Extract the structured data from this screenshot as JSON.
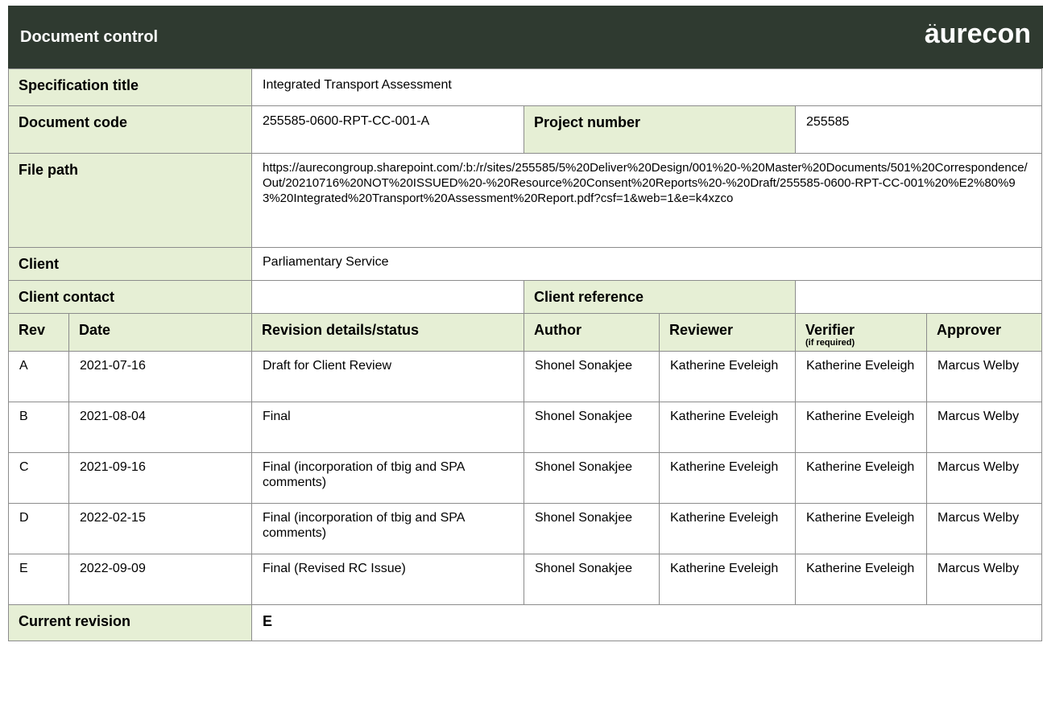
{
  "header": {
    "title": "Document control",
    "logo_text": "aurecon"
  },
  "rows": {
    "spec_title_label": "Specification title",
    "spec_title_value": "Integrated Transport Assessment",
    "doc_code_label": "Document code",
    "doc_code_value": "255585-0600-RPT-CC-001-A",
    "project_number_label": "Project number",
    "project_number_value": "255585",
    "file_path_label": "File path",
    "file_path_value": "https://aurecongroup.sharepoint.com/:b:/r/sites/255585/5%20Deliver%20Design/001%20-%20Master%20Documents/501%20Correspondence/Out/20210716%20NOT%20ISSUED%20-%20Resource%20Consent%20Reports%20-%20Draft/255585-0600-RPT-CC-001%20%E2%80%93%20Integrated%20Transport%20Assessment%20Report.pdf?csf=1&web=1&e=k4xzco",
    "client_label": "Client",
    "client_value": "Parliamentary Service",
    "client_contact_label": "Client contact",
    "client_contact_value": "",
    "client_reference_label": "Client reference",
    "client_reference_value": ""
  },
  "revision_table": {
    "headers": {
      "rev": "Rev",
      "date": "Date",
      "details": "Revision details/status",
      "author": "Author",
      "reviewer": "Reviewer",
      "verifier": "Verifier",
      "verifier_note": "(if required)",
      "approver": "Approver"
    },
    "rows": [
      {
        "rev": "A",
        "date": "2021-07-16",
        "details": "Draft for Client Review",
        "author": "Shonel Sonakjee",
        "reviewer": "Katherine Eveleigh",
        "verifier": "Katherine Eveleigh",
        "approver": "Marcus Welby"
      },
      {
        "rev": "B",
        "date": "2021-08-04",
        "details": "Final",
        "author": "Shonel Sonakjee",
        "reviewer": "Katherine Eveleigh",
        "verifier": "Katherine Eveleigh",
        "approver": "Marcus Welby"
      },
      {
        "rev": "C",
        "date": "2021-09-16",
        "details": "Final (incorporation of tbig and SPA comments)",
        "author": "Shonel Sonakjee",
        "reviewer": "Katherine Eveleigh",
        "verifier": "Katherine Eveleigh",
        "approver": "Marcus Welby"
      },
      {
        "rev": "D",
        "date": "2022-02-15",
        "details": "Final (incorporation of tbig and SPA comments)",
        "author": "Shonel Sonakjee",
        "reviewer": "Katherine Eveleigh",
        "verifier": "Katherine Eveleigh",
        "approver": "Marcus Welby"
      },
      {
        "rev": "E",
        "date": "2022-09-09",
        "details": "Final (Revised RC Issue)",
        "author": "Shonel Sonakjee",
        "reviewer": "Katherine Eveleigh",
        "verifier": "Katherine Eveleigh",
        "approver": "Marcus Welby"
      }
    ]
  },
  "current_revision": {
    "label": "Current revision",
    "value": "E"
  },
  "colors": {
    "header_bg": "#2f3a30",
    "label_bg": "#e6efd5"
  }
}
